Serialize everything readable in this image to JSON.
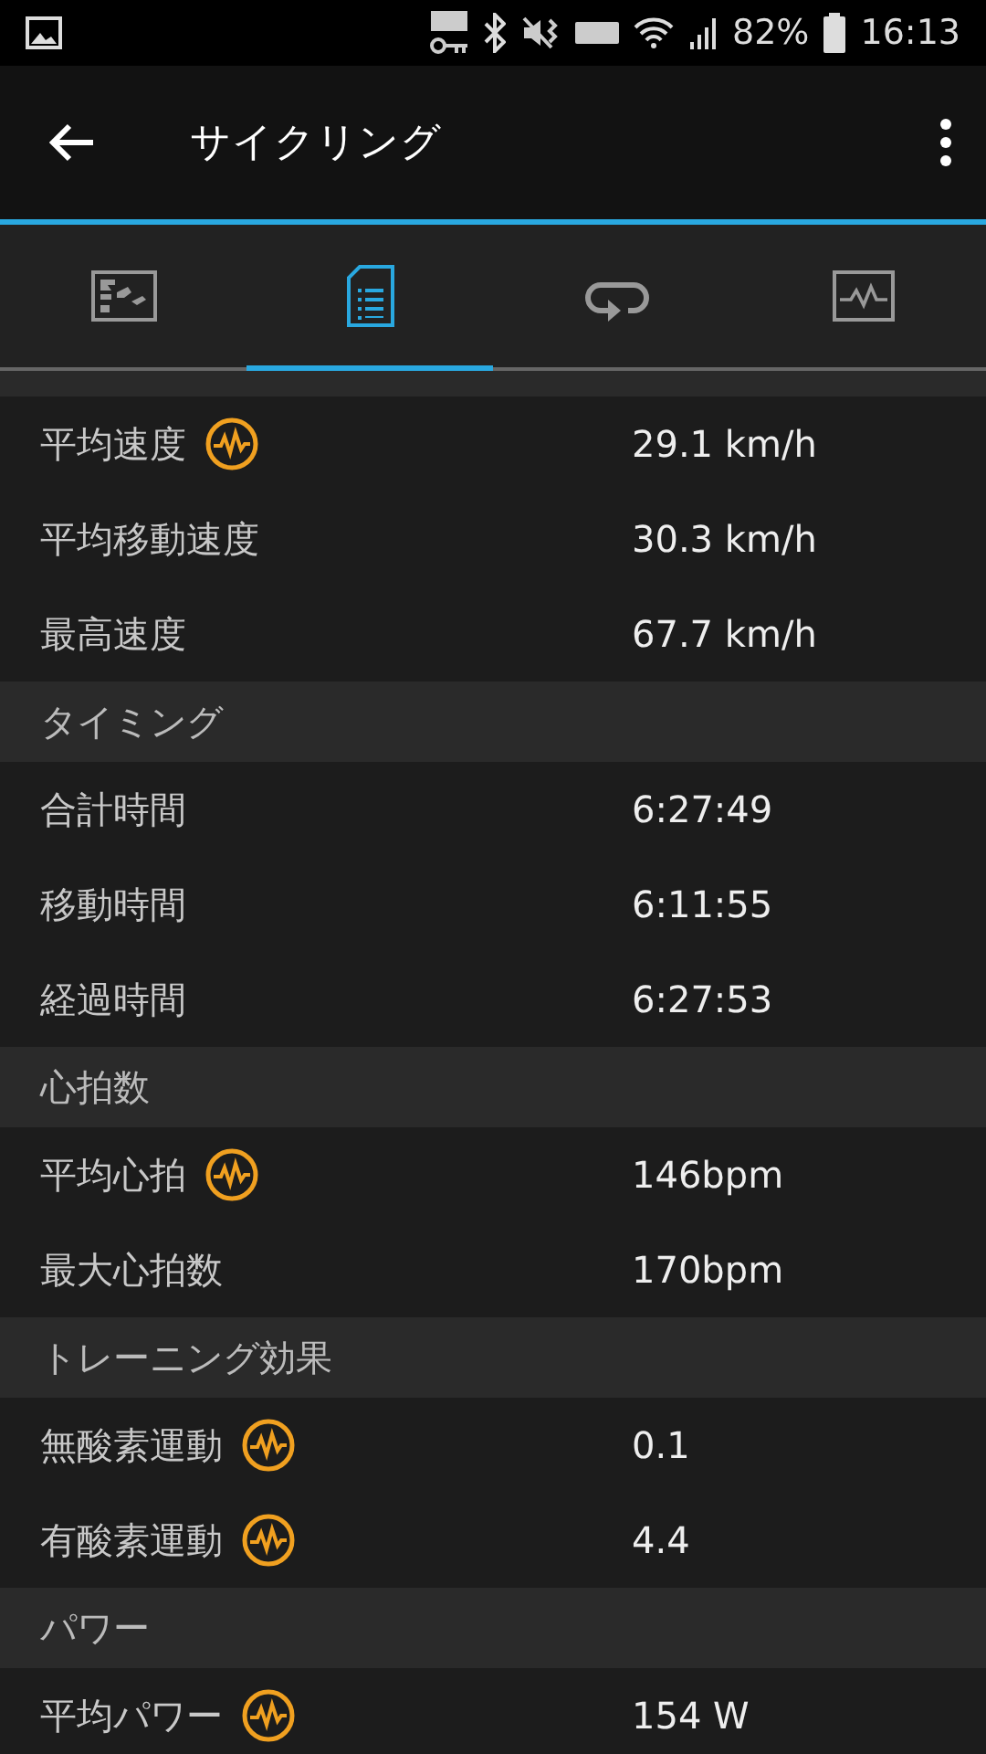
{
  "status_bar": {
    "battery": "82%",
    "time": "16:13"
  },
  "app_bar": {
    "title": "サイクリング"
  },
  "tabs": [
    {
      "kind": "map",
      "selected": false
    },
    {
      "kind": "list",
      "selected": true
    },
    {
      "kind": "loop",
      "selected": false
    },
    {
      "kind": "chart",
      "selected": false
    }
  ],
  "sections": [
    {
      "rows": [
        {
          "label": "平均速度",
          "value": "29.1 km/h",
          "insight": true
        },
        {
          "label": "平均移動速度",
          "value": "30.3 km/h",
          "insight": false
        },
        {
          "label": "最高速度",
          "value": "67.7 km/h",
          "insight": false
        }
      ]
    },
    {
      "title": "タイミング",
      "rows": [
        {
          "label": "合計時間",
          "value": "6:27:49",
          "insight": false
        },
        {
          "label": "移動時間",
          "value": "6:11:55",
          "insight": false
        },
        {
          "label": "経過時間",
          "value": "6:27:53",
          "insight": false
        }
      ]
    },
    {
      "title": "心拍数",
      "rows": [
        {
          "label": "平均心拍",
          "value": "146bpm",
          "insight": true
        },
        {
          "label": "最大心拍数",
          "value": "170bpm",
          "insight": false
        }
      ]
    },
    {
      "title": "トレーニング効果",
      "rows": [
        {
          "label": "無酸素運動",
          "value": "0.1",
          "insight": true
        },
        {
          "label": "有酸素運動",
          "value": "4.4",
          "insight": true
        }
      ]
    },
    {
      "title": "パワー",
      "rows": [
        {
          "label": "平均パワー",
          "value": "154 W",
          "insight": true
        }
      ]
    }
  ]
}
